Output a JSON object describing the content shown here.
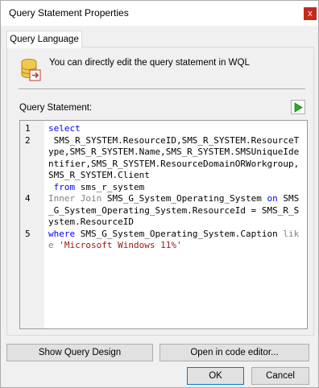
{
  "window": {
    "title": "Query Statement Properties",
    "close_label": "x"
  },
  "tabs": [
    {
      "label": "Query Language"
    }
  ],
  "info": {
    "text": "You can directly edit the query statement in WQL"
  },
  "query": {
    "label": "Query Statement:",
    "lines": [
      {
        "num": "1",
        "segments": [
          {
            "text": "select",
            "kind": "kw"
          }
        ]
      },
      {
        "num": "2",
        "segments": [
          {
            "text": " SMS_R_SYSTEM.ResourceID,SMS_R_SYSTEM.ResourceType,SMS_R_SYSTEM.Name,SMS_R_SYSTEM.SMSUniqueIdentifier,SMS_R_SYSTEM.ResourceDomainORWorkgroup,SMS_R_SYSTEM.Client",
            "kind": "plain"
          }
        ]
      },
      {
        "num": "",
        "segments": [
          {
            "text": " from",
            "kind": "kw"
          },
          {
            "text": " sms_r_system",
            "kind": "plain"
          }
        ]
      },
      {
        "num": "4",
        "segments": [
          {
            "text": "Inner Join",
            "kind": "gr"
          },
          {
            "text": " SMS_G_System_Operating_System ",
            "kind": "plain"
          },
          {
            "text": "on",
            "kind": "kw"
          },
          {
            "text": " SMS_G_System_Operating_System.ResourceId = SMS_R_System.ResourceID",
            "kind": "plain"
          }
        ]
      },
      {
        "num": "5",
        "segments": [
          {
            "text": "where",
            "kind": "kw"
          },
          {
            "text": " SMS_G_System_Operating_System.Caption ",
            "kind": "plain"
          },
          {
            "text": "like",
            "kind": "gr"
          },
          {
            "text": " ",
            "kind": "plain"
          },
          {
            "text": "'Microsoft Windows 11%'",
            "kind": "str"
          }
        ]
      }
    ]
  },
  "buttons": {
    "show_query_design": "Show Query Design",
    "open_in_code_editor": "Open in code editor...",
    "ok": "OK",
    "cancel": "Cancel"
  },
  "colors": {
    "keyword": "#0000ff",
    "gray_keyword": "#808080",
    "string": "#a31515",
    "close_button": "#c42b1c",
    "run_arrow": "#2ea82e"
  },
  "icons": {
    "info": "database-query-icon",
    "run": "run-query-icon",
    "close": "close-icon"
  }
}
